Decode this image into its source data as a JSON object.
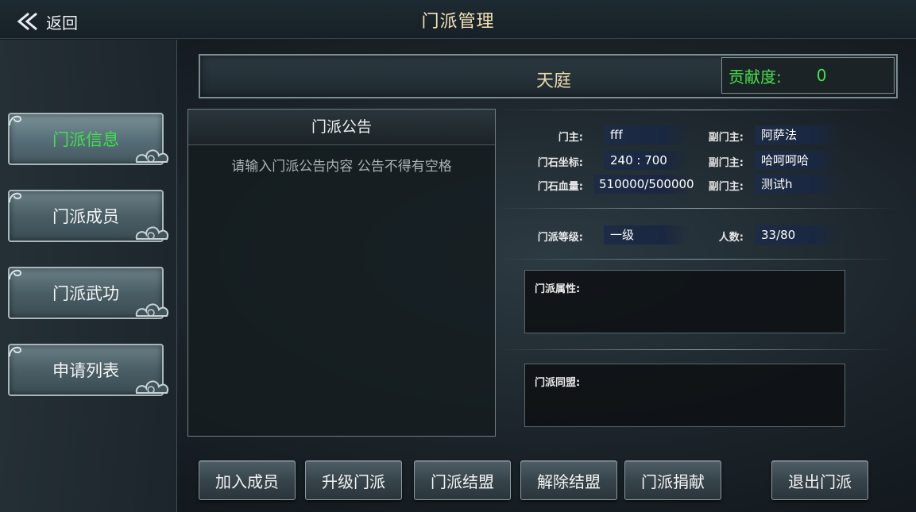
{
  "header": {
    "back_label": "返回",
    "title": "门派管理"
  },
  "sidebar": {
    "items": [
      {
        "label": "门派信息",
        "active": true
      },
      {
        "label": "门派成员",
        "active": false
      },
      {
        "label": "门派武功",
        "active": false
      },
      {
        "label": "申请列表",
        "active": false
      }
    ]
  },
  "banner": {
    "sect_name": "天庭",
    "contribution_label": "贡献度:",
    "contribution_value": "0"
  },
  "notice": {
    "title": "门派公告",
    "placeholder": "请输入门派公告内容 公告不得有空格"
  },
  "info": {
    "leader_label": "门主:",
    "leader_value": "fff",
    "vice1_label": "副门主:",
    "vice1_value": "阿萨法",
    "coord_label": "门石坐标:",
    "coord_value": "240 : 700",
    "vice2_label": "副门主:",
    "vice2_value": "哈呵呵哈",
    "hp_label": "门石血量:",
    "hp_value": "510000/500000",
    "vice3_label": "副门主:",
    "vice3_value": "测试h",
    "level_label": "门派等级:",
    "level_value": "一级",
    "count_label": "人数:",
    "count_value": "33/80",
    "attr_label": "门派属性:",
    "alliance_label": "门派同盟:"
  },
  "actions": {
    "join": "加入成员",
    "upgrade": "升级门派",
    "ally": "门派结盟",
    "unally": "解除结盟",
    "donate": "门派捐献",
    "quit": "退出门派"
  },
  "colors": {
    "active_text": "#3fe04a",
    "contribution": "#46e04b",
    "title": "#f3e3b6"
  }
}
